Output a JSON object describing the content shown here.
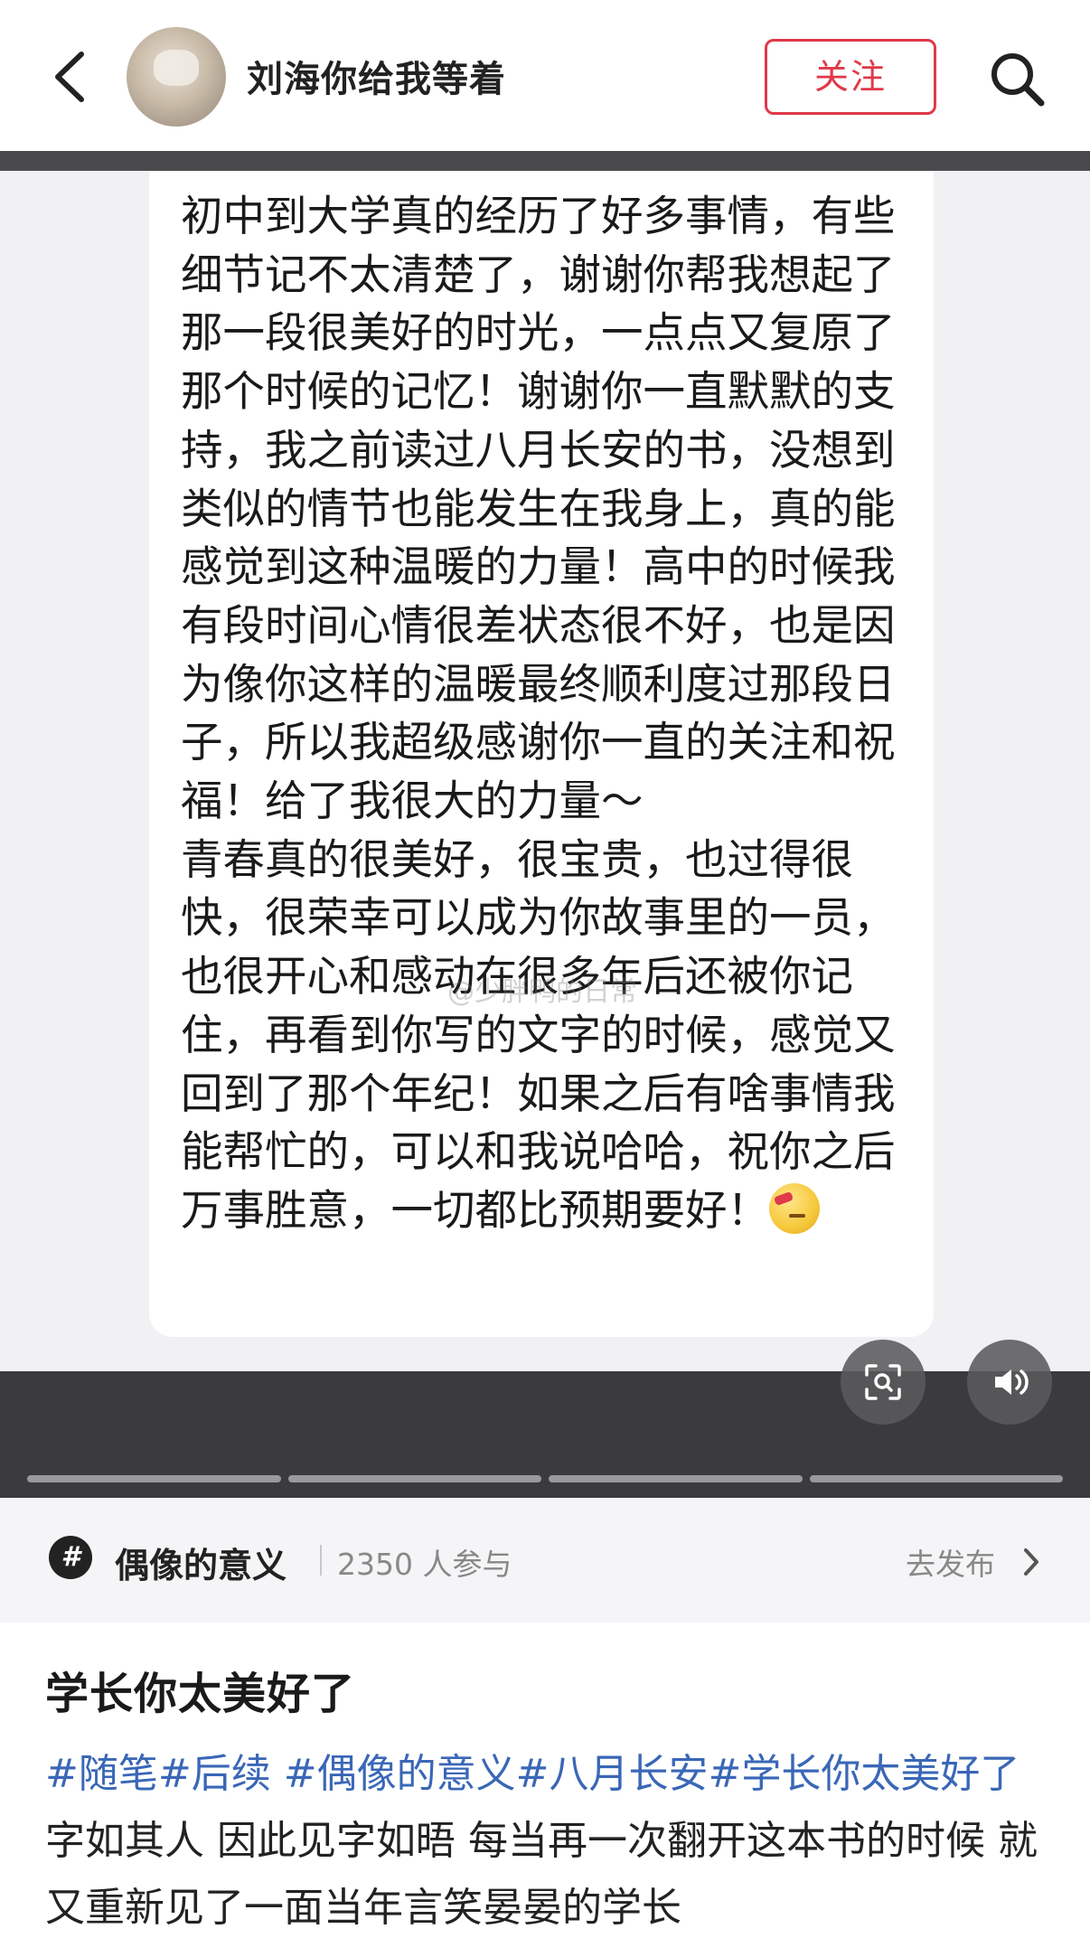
{
  "header": {
    "username": "刘海你给我等着",
    "follow_label": "关注"
  },
  "message": {
    "text": "初中到大学真的经历了好多事情，有些细节记不太清楚了，谢谢你帮我想起了那一段很美好的时光，一点点又复原了那个时候的记忆！谢谢你一直默默的支持，我之前读过八月长安的书，没想到类似的情节也能发生在我身上，真的能感觉到这种温暖的力量！高中的时候我有段时间心情很差状态很不好，也是因为像你这样的温暖最终顺利度过那段日子，所以我超级感谢你一直的关注和祝福！给了我很大的力量～\n青春真的很美好，很宝贵，也过得很快，很荣幸可以成为你故事里的一员，也很开心和感动在很多年后还被你记住，再看到你写的文字的时候，感觉又回到了那个年纪！如果之后有啥事情我能帮忙的，可以和我说哈哈，祝你之后万事胜意，一切都比预期要好！",
    "watermark": "@少胖鸭的日常",
    "emoji": "eye-patch-smile-emoji"
  },
  "media_controls": {
    "ocr_icon": "scan-text-icon",
    "volume_icon": "speaker-icon",
    "progress_segments": 4
  },
  "topic": {
    "name": "偶像的意义",
    "participants": "2350 人参与",
    "action": "去发布"
  },
  "post": {
    "title": "学长你太美好了",
    "tags": [
      "#随笔",
      "#后续 ",
      "#偶像的意义",
      "#八月长安",
      "#学长你太美好了"
    ],
    "body": " 字如其人 因此见字如晤 每当再一次翻开这本书的时候 就又重新见了一面当年言笑晏晏的学长"
  },
  "colors": {
    "accent": "#e0384a",
    "tag": "#3a67b7"
  }
}
